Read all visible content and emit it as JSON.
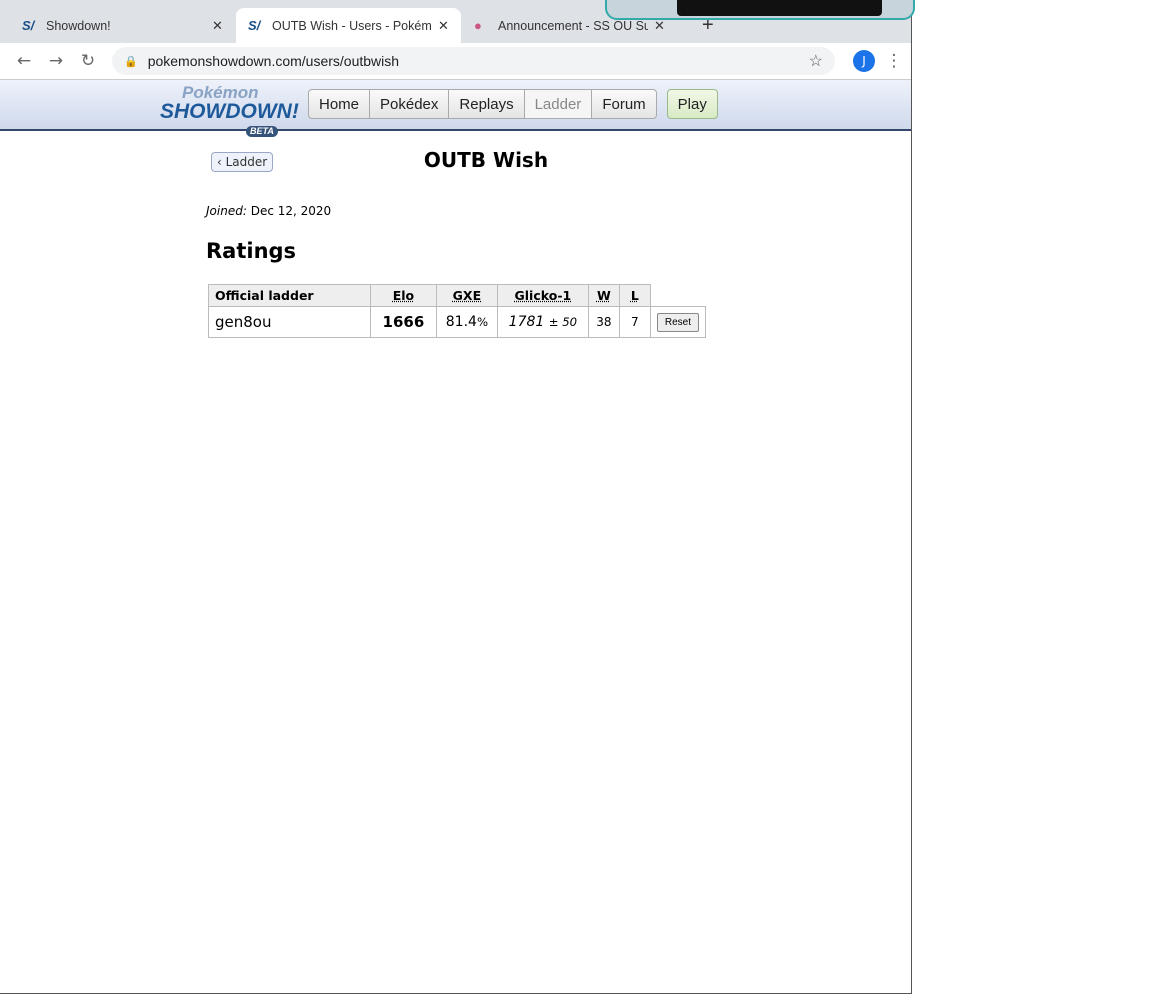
{
  "browser": {
    "tabs": [
      {
        "title": "Showdown!"
      },
      {
        "title": "OUTB Wish - Users - Pokémon"
      },
      {
        "title": "Announcement - SS OU Suspe"
      }
    ],
    "url": "pokemonshowdown.com/users/outbwish",
    "profile_initial": "J"
  },
  "site": {
    "logo": {
      "top": "Pokémon",
      "main": "SHOWDOWN!",
      "badge": "BETA"
    },
    "nav": [
      "Home",
      "Pokédex",
      "Replays",
      "Ladder",
      "Forum"
    ],
    "play": "Play"
  },
  "page": {
    "back_label": "Ladder",
    "username": "OUTB Wish",
    "joined_label": "Joined:",
    "joined_date": "Dec 12, 2020",
    "ratings_heading": "Ratings",
    "table": {
      "headers": [
        "Official ladder",
        "Elo",
        "GXE",
        "Glicko-1",
        "W",
        "L"
      ],
      "rows": [
        {
          "format": "gen8ou",
          "elo": "1666",
          "gxe": "81.4",
          "gxe_unit": "%",
          "glicko": "1781",
          "glicko_dev": "± 50",
          "w": "38",
          "l": "7",
          "action": "Reset"
        }
      ]
    }
  }
}
